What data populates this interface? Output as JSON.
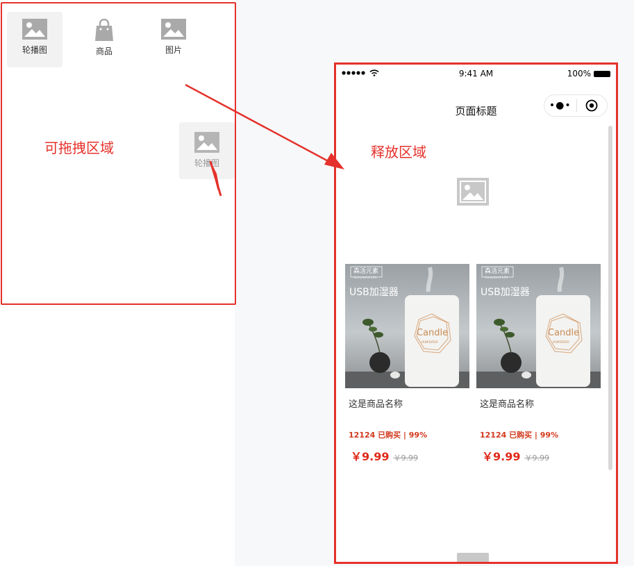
{
  "components": [
    {
      "label": "轮播图",
      "icon": "image-icon"
    },
    {
      "label": "商品",
      "icon": "shopping-bag-icon"
    },
    {
      "label": "图片",
      "icon": "image-icon"
    }
  ],
  "drag_ghost": {
    "label": "轮播图",
    "icon": "image-icon"
  },
  "annotations": {
    "drag_area": "可拖拽区域",
    "drop_area": "释放区域"
  },
  "phone": {
    "status": {
      "time": "9:41 AM",
      "battery": "100%"
    },
    "nav_title": "页面标题",
    "capsule": {
      "more": "•●•"
    },
    "products": [
      {
        "image_text": {
          "brand": "森活元素",
          "sub": "Sunyland Life",
          "title": "USB加湿器",
          "candle": "Candle",
          "hum": "HUMIDIFIER"
        },
        "name": "这是商品名称",
        "stats": "12124 已购买 | 99%",
        "price": "￥9.99",
        "original": "￥9.99"
      },
      {
        "image_text": {
          "brand": "森活元素",
          "sub": "Sunyland Life",
          "title": "USB加湿器",
          "candle": "Candle",
          "hum": "HUMIDIFIER"
        },
        "name": "这是商品名称",
        "stats": "12124 已购买 | 99%",
        "price": "￥9.99",
        "original": "￥9.99"
      }
    ]
  },
  "colors": {
    "accent_red": "#e5312b",
    "price_red": "#e02a1a",
    "icon_gray": "#a9a9a9"
  }
}
